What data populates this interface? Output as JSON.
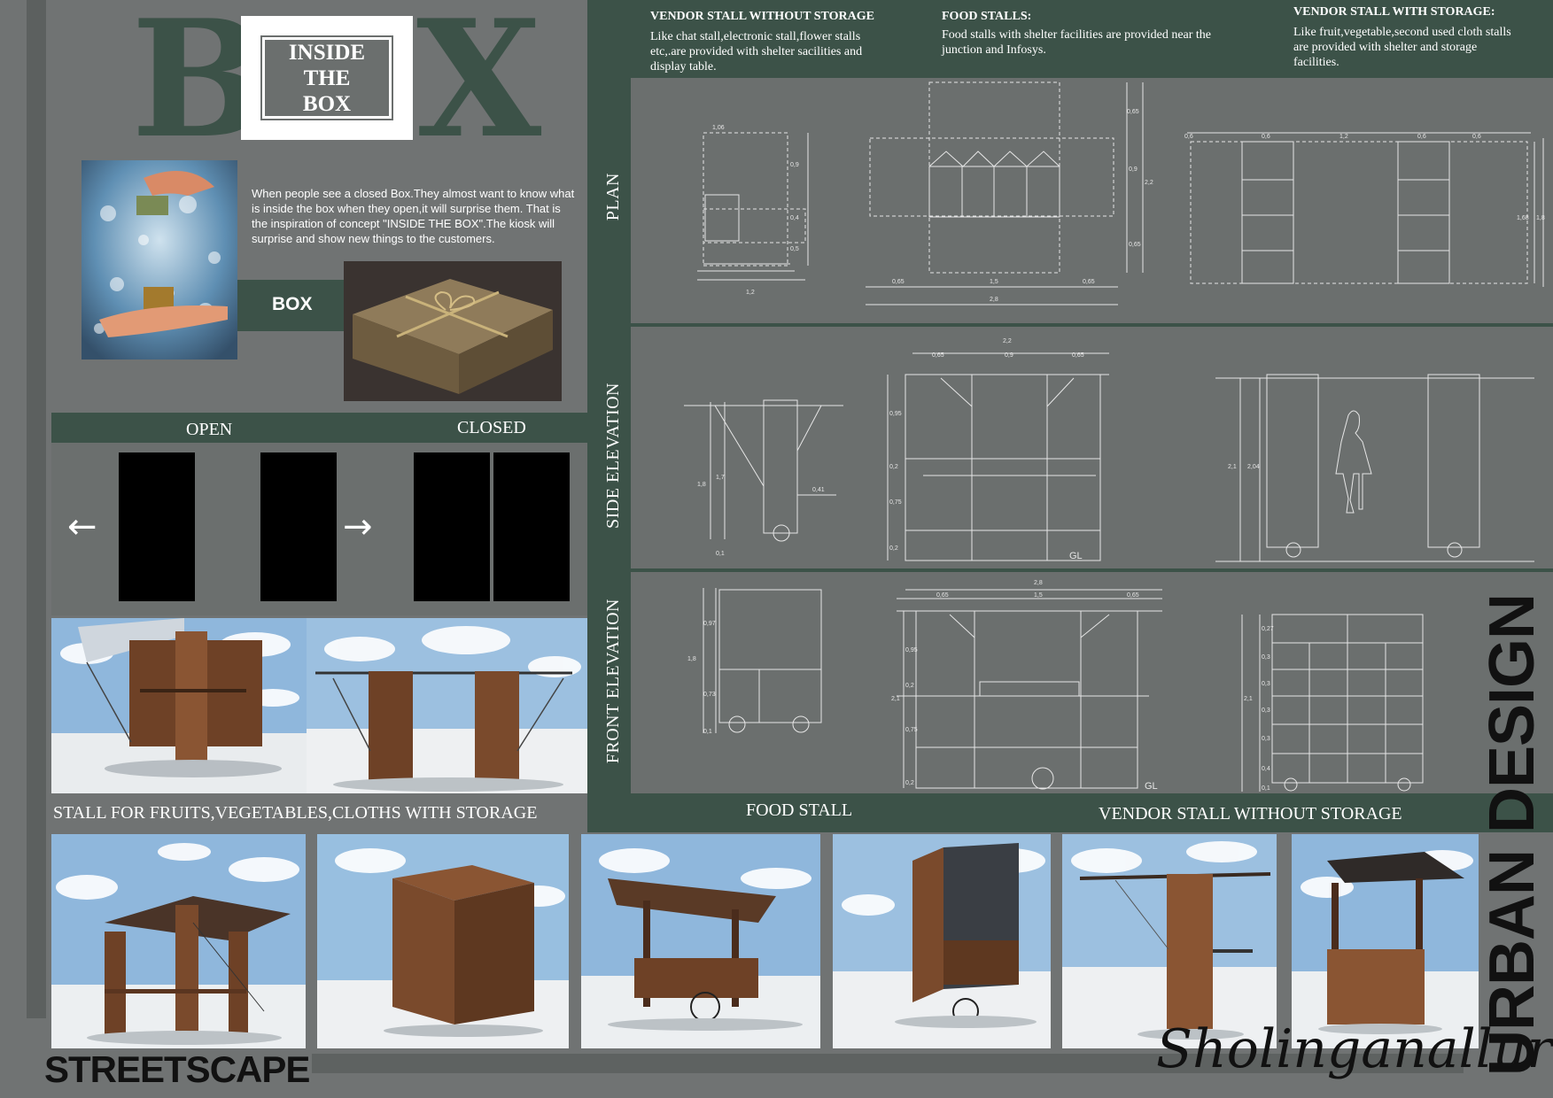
{
  "title": {
    "left_letter": "B",
    "right_letter": "X",
    "box_text": [
      "INSIDE",
      "THE",
      "BOX"
    ]
  },
  "concept": {
    "paragraph": "When people see a closed Box.They almost want to know what is inside the box when they open,it will surprise them. That is the inspiration of concept \"INSIDE THE BOX\".The kiosk will surprise and show new things to the customers.",
    "box_label": "BOX"
  },
  "open_closed": {
    "open_label": "OPEN",
    "closed_label": "CLOSED",
    "left_arrow": "←",
    "right_arrow": "→"
  },
  "top_descriptions": [
    {
      "heading": "VENDOR STALL WITHOUT STORAGE",
      "text": "Like chat stall,electronic stall,flower stalls etc,.are provided with shelter sacilities and display table."
    },
    {
      "heading": "FOOD STALLS:",
      "text": "Food stalls with shelter facilities are provided near the junction and Infosys."
    },
    {
      "heading": "VENDOR STALL WITH STORAGE:",
      "text": "Like fruit,vegetable,second used cloth stalls are provided with shelter and storage facilities."
    }
  ],
  "drawing_rows": [
    "PLAN",
    "SIDE ELEVATION",
    "FRONT ELEVATION"
  ],
  "dimensions": {
    "plan_a": [
      "0,9",
      "0,4",
      "0,5",
      "1,06",
      "1,2"
    ],
    "plan_b": [
      "0,65",
      "0,9",
      "0,65",
      "2,2",
      "0,65",
      "1,5",
      "0,65",
      "2,8"
    ],
    "plan_c": [
      "0,6",
      "0,6",
      "1,2",
      "0,6",
      "0,6",
      "1,68",
      "1,8"
    ],
    "side_a": [
      "1,8",
      "1,7",
      "0,41",
      "0,1"
    ],
    "side_b": [
      "2,2",
      "0,65",
      "0,9",
      "0,65",
      "0,95",
      "0,2",
      "0,75",
      "0,2",
      "GL"
    ],
    "side_c": [
      "2,1",
      "2,04"
    ],
    "front_a": [
      "0,97",
      "1,8",
      "0,73",
      "0,1"
    ],
    "front_b": [
      "2,8",
      "0,65",
      "1,5",
      "0,65",
      "0,95",
      "2,1",
      "0,2",
      "0,75",
      "0,2",
      "GL"
    ],
    "front_c": [
      "0,27",
      "0,3",
      "0,3",
      "0,3",
      "0,3",
      "0,4",
      "2,1",
      "0,1"
    ]
  },
  "bottom_labels": {
    "fruits": "STALL FOR FRUITS,VEGETABLES,CLOTHS WITH STORAGE",
    "food": "FOOD STALL",
    "vendor": "VENDOR STALL WITHOUT STORAGE"
  },
  "footer": {
    "streetscape": "STREETSCAPE",
    "location": "Sholinganallur",
    "urban_design": "URBAN DESIGN"
  },
  "colors": {
    "green": "#3c5248",
    "grey": "#707373",
    "wood": "#7a4a2c",
    "sky": "#8fb7dc"
  }
}
